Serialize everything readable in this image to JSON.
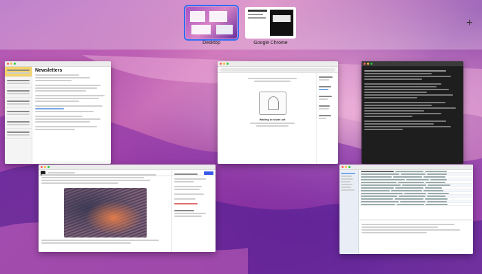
{
  "spaces": [
    {
      "label": "Desktop",
      "active": true
    },
    {
      "label": "Google Chrome",
      "active": false
    }
  ],
  "add_space_symbol": "+",
  "accent_color": "#2f6df6",
  "windows": {
    "notes": {
      "heading": "Newsletters"
    },
    "assistant": {
      "empty_title": "Waiting to share yet"
    },
    "terminal": {},
    "wordpress": {},
    "activity": {}
  }
}
